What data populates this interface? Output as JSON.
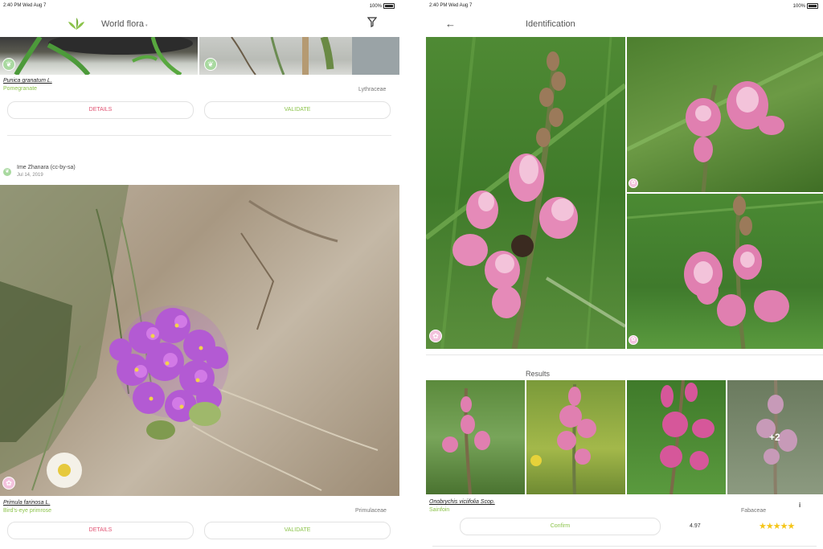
{
  "left": {
    "status": {
      "time": "2:40 PM",
      "date": "Wed Aug 7",
      "battery": "100%"
    },
    "header": {
      "title": "World flora",
      "logo_icon": "plant-leaves-icon",
      "filter_icon": "filter-icon"
    },
    "card1": {
      "scientific_name": "Punica granatum L.",
      "common_name": "Pomegranate",
      "family": "Lythraceae",
      "details_label": "DETAILS",
      "validate_label": "VALIDATE"
    },
    "card2": {
      "author": "Ime Zhanara (cc-by-sa)",
      "date": "Jul 14, 2019",
      "scientific_name": "Primula farinosa L.",
      "common_name": "Bird's-eye primrose",
      "family": "Primulaceae",
      "details_label": "DETAILS",
      "validate_label": "VALIDATE"
    }
  },
  "right": {
    "status": {
      "time": "2:40 PM",
      "date": "Wed Aug 7",
      "battery": "100%"
    },
    "header": {
      "title": "Identification",
      "back_icon": "back-arrow-icon"
    },
    "results_label": "Results",
    "more_count": "+2",
    "result": {
      "scientific_name": "Onobrychis viciifolia Scop.",
      "common_name": "Sainfoin",
      "family": "Fabaceae",
      "info_icon": "info-icon",
      "confirm_label": "Confirm",
      "score": "4.97",
      "stars": "★★★★★"
    }
  },
  "colors": {
    "accent_green": "#8bc34a",
    "accent_red": "#e05070",
    "star_yellow": "#f5c518"
  }
}
